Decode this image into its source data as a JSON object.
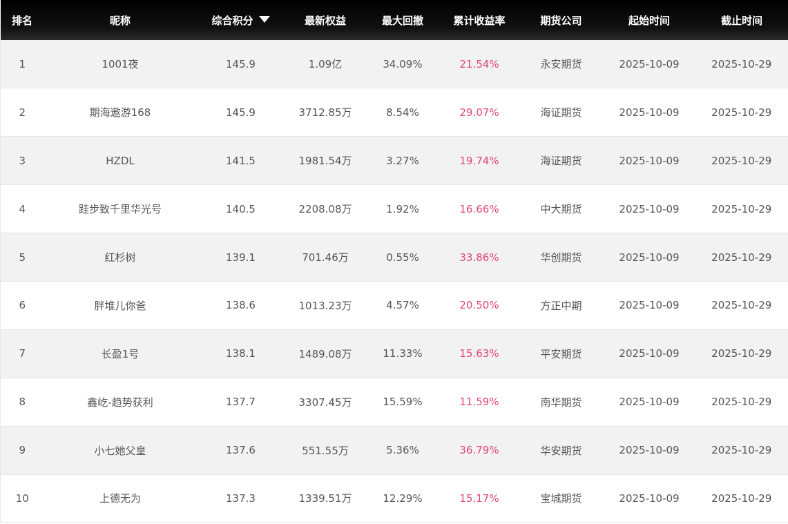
{
  "colors": {
    "header_bg": "#000000",
    "header_text": "#ffffff",
    "row_odd": "#f2f2f2",
    "row_even": "#ffffff",
    "text": "#555555",
    "return_text": "#e0457b"
  },
  "header": {
    "rank": "排名",
    "nickname": "昵称",
    "score": "综合积分",
    "score_sort_icon": "sort-desc-icon",
    "equity": "最新权益",
    "drawdown": "最大回撤",
    "return": "累计收益率",
    "company": "期货公司",
    "start": "起始时间",
    "end": "截止时间"
  },
  "rows": [
    {
      "rank": "1",
      "nickname": "1001夜",
      "score": "145.9",
      "equity": "1.09亿",
      "drawdown": "34.09%",
      "return": "21.54%",
      "company": "永安期货",
      "start": "2025-10-09",
      "end": "2025-10-29"
    },
    {
      "rank": "2",
      "nickname": "期海遨游168",
      "score": "145.9",
      "equity": "3712.85万",
      "drawdown": "8.54%",
      "return": "29.07%",
      "company": "海证期货",
      "start": "2025-10-09",
      "end": "2025-10-29"
    },
    {
      "rank": "3",
      "nickname": "HZDL",
      "score": "141.5",
      "equity": "1981.54万",
      "drawdown": "3.27%",
      "return": "19.74%",
      "company": "海证期货",
      "start": "2025-10-09",
      "end": "2025-10-29"
    },
    {
      "rank": "4",
      "nickname": "跬步致千里华光号",
      "score": "140.5",
      "equity": "2208.08万",
      "drawdown": "1.92%",
      "return": "16.66%",
      "company": "中大期货",
      "start": "2025-10-09",
      "end": "2025-10-29"
    },
    {
      "rank": "5",
      "nickname": "红杉树",
      "score": "139.1",
      "equity": "701.46万",
      "drawdown": "0.55%",
      "return": "33.86%",
      "company": "华创期货",
      "start": "2025-10-09",
      "end": "2025-10-29"
    },
    {
      "rank": "6",
      "nickname": "胖堆儿你爸",
      "score": "138.6",
      "equity": "1013.23万",
      "drawdown": "4.57%",
      "return": "20.50%",
      "company": "方正中期",
      "start": "2025-10-09",
      "end": "2025-10-29"
    },
    {
      "rank": "7",
      "nickname": "长盈1号",
      "score": "138.1",
      "equity": "1489.08万",
      "drawdown": "11.33%",
      "return": "15.63%",
      "company": "平安期货",
      "start": "2025-10-09",
      "end": "2025-10-29"
    },
    {
      "rank": "8",
      "nickname": "鑫屹-趋势获利",
      "score": "137.7",
      "equity": "3307.45万",
      "drawdown": "15.59%",
      "return": "11.59%",
      "company": "南华期货",
      "start": "2025-10-09",
      "end": "2025-10-29"
    },
    {
      "rank": "9",
      "nickname": "小七她父皇",
      "score": "137.6",
      "equity": "551.55万",
      "drawdown": "5.36%",
      "return": "36.79%",
      "company": "华安期货",
      "start": "2025-10-09",
      "end": "2025-10-29"
    },
    {
      "rank": "10",
      "nickname": "上德无为",
      "score": "137.3",
      "equity": "1339.51万",
      "drawdown": "12.29%",
      "return": "15.17%",
      "company": "宝城期货",
      "start": "2025-10-09",
      "end": "2025-10-29"
    }
  ]
}
